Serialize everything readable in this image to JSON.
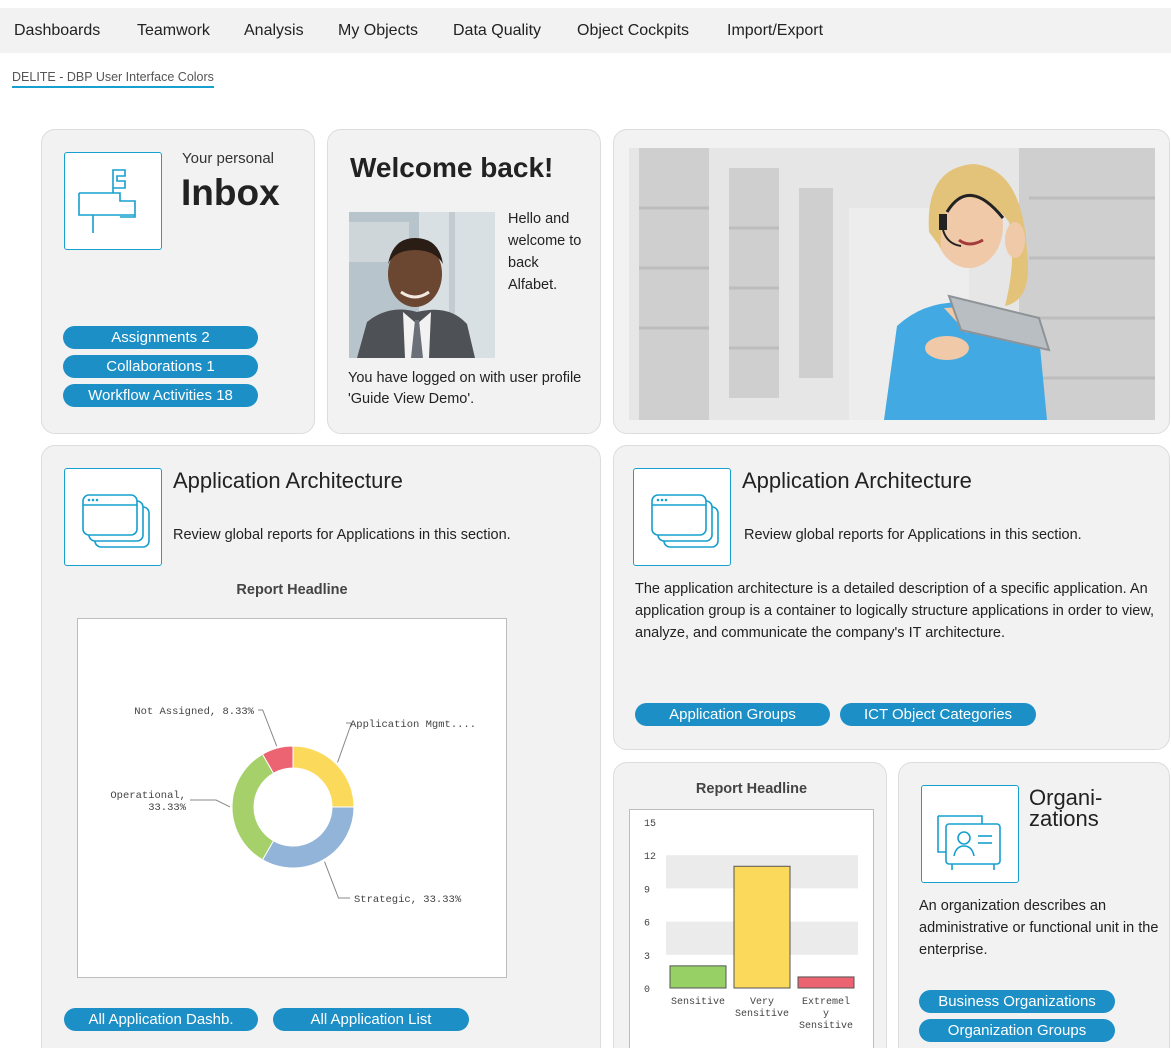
{
  "topnav": {
    "items": [
      {
        "label": "Dashboards"
      },
      {
        "label": "Teamwork"
      },
      {
        "label": "Analysis"
      },
      {
        "label": "My Objects"
      },
      {
        "label": "Data Quality"
      },
      {
        "label": "Object Cockpits"
      },
      {
        "label": "Import/Export"
      }
    ]
  },
  "breadcrumb": {
    "label": "DELITE - DBP User Interface Colors"
  },
  "colors": {
    "accent": "#1c8fc6",
    "card_bg": "#f2f2f2",
    "icon_stroke": "#17a0cf"
  },
  "inbox": {
    "subtitle": "Your personal",
    "title": "Inbox",
    "icon": "mailbox-icon",
    "buttons": [
      {
        "label": "Assignments 2"
      },
      {
        "label": "Collaborations 1"
      },
      {
        "label": "Workflow Activities 18"
      }
    ]
  },
  "welcome": {
    "title": "Welcome back!",
    "greeting": "Hello and welcome to back Alfabet.",
    "login_info": "You have logged on with user profile 'Guide View Demo'.",
    "photo": "user-portrait"
  },
  "hero": {
    "photo": "support-agent-warehouse"
  },
  "app_arch_left": {
    "title": "Application Architecture",
    "subtitle": "Review global reports for Applications in this section.",
    "icon": "windows-stack-icon",
    "buttons": [
      {
        "label": "All Application Dashb."
      },
      {
        "label": "All Application List"
      }
    ]
  },
  "app_arch_right": {
    "title": "Application Architecture",
    "subtitle": "Review global reports for Applications in this section.",
    "icon": "windows-stack-icon",
    "description": "The application architecture is a detailed description of a specific application. An application group is a container to logically structure applications in order to view, analyze, and communicate the company's IT architecture.",
    "buttons": [
      {
        "label": "Application Groups"
      },
      {
        "label": "ICT Object Categories"
      }
    ]
  },
  "organizations": {
    "title": "Organi- zations",
    "icon": "org-chart-icon",
    "description": "An organization describes an administrative or functional unit in the enterprise.",
    "buttons": [
      {
        "label": "Business Organizations"
      },
      {
        "label": "Organization Groups"
      }
    ]
  },
  "chart_data": [
    {
      "type": "pie",
      "title": "Report Headline",
      "donut": true,
      "slices": [
        {
          "label": "Application Mgmt....",
          "value": 25.0,
          "color": "#fbd95a"
        },
        {
          "label": "Strategic, 33.33%",
          "value": 33.33,
          "color": "#92b4d9"
        },
        {
          "label": "Operational, 33.33%",
          "value": 33.33,
          "color": "#a6d06a"
        },
        {
          "label": "Not Assigned, 8.33%",
          "value": 8.33,
          "color": "#ec6371"
        }
      ]
    },
    {
      "type": "bar",
      "title": "Report Headline",
      "categories": [
        "Sensitive",
        "Very Sensitive",
        "Extremely Sensitive"
      ],
      "values": [
        2,
        11,
        1
      ],
      "colors": [
        "#97d065",
        "#fbd95a",
        "#ec6371"
      ],
      "ylim": [
        0,
        15
      ],
      "yticks": [
        "0",
        "3",
        "6",
        "9",
        "12",
        "15"
      ],
      "grid": "alternating bands"
    }
  ]
}
